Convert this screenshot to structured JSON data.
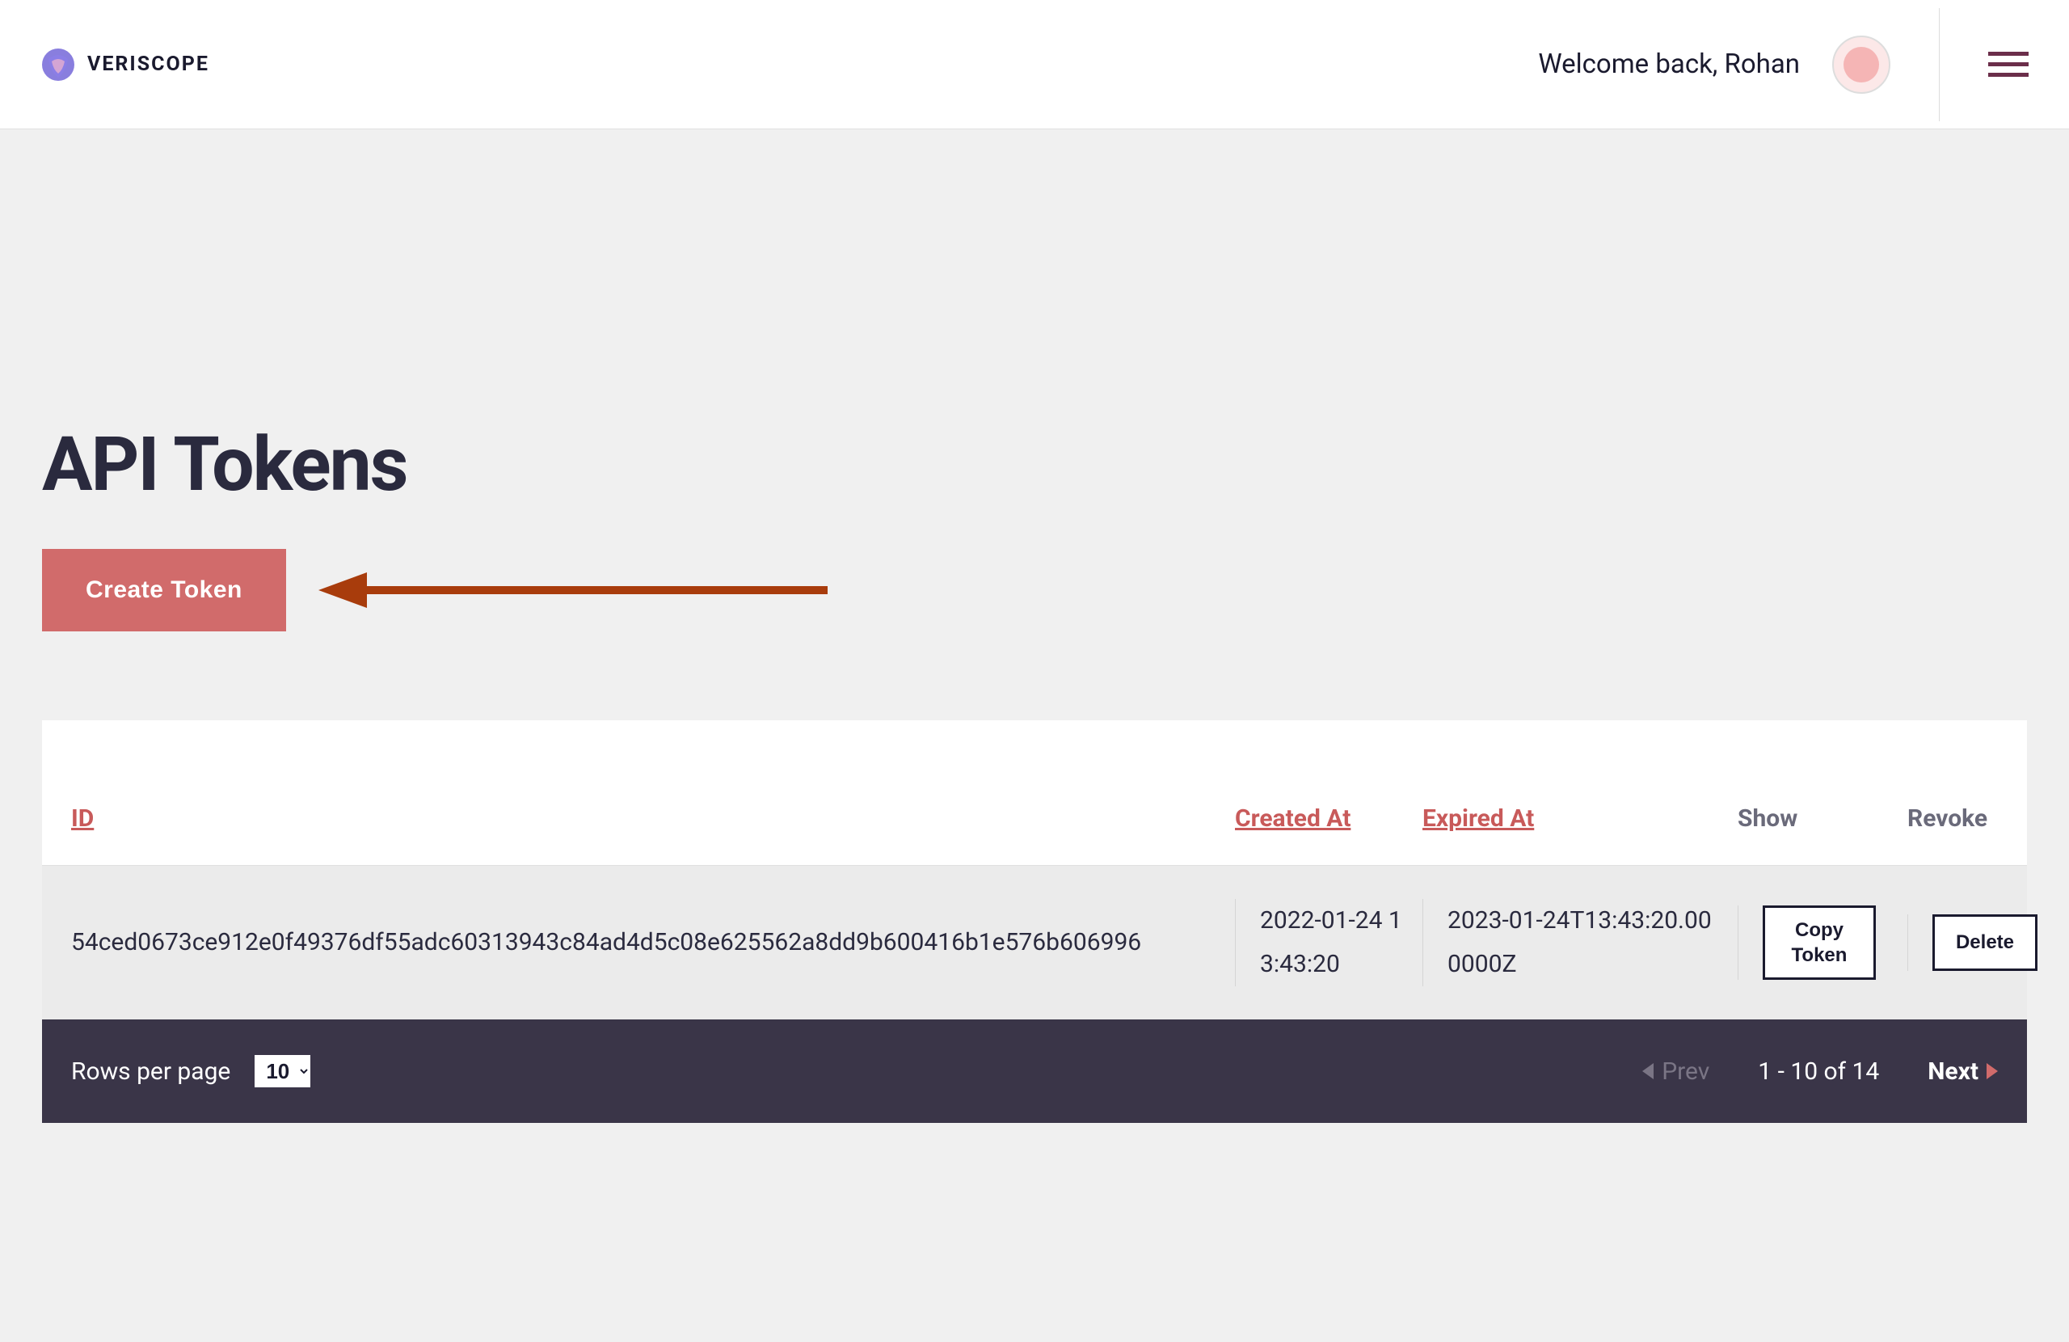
{
  "header": {
    "brand": "VERISCOPE",
    "welcome": "Welcome back, Rohan"
  },
  "page": {
    "title": "API Tokens",
    "create_button": "Create Token"
  },
  "table": {
    "headers": {
      "id": "ID",
      "created_at": "Created At",
      "expired_at": "Expired At",
      "show": "Show",
      "revoke": "Revoke"
    },
    "rows": [
      {
        "id": "54ced0673ce912e0f49376df55adc60313943c84ad4d5c08e625562a8dd9b600416b1e576b606996",
        "created_at": "2022-01-24 13:43:20",
        "expired_at": "2023-01-24T13:43:20.000000Z",
        "copy_label": "Copy Token",
        "delete_label": "Delete"
      }
    ]
  },
  "pagination": {
    "rows_label": "Rows per page",
    "rows_value": "10",
    "prev": "Prev",
    "range": "1 - 10 of 14",
    "next": "Next"
  }
}
